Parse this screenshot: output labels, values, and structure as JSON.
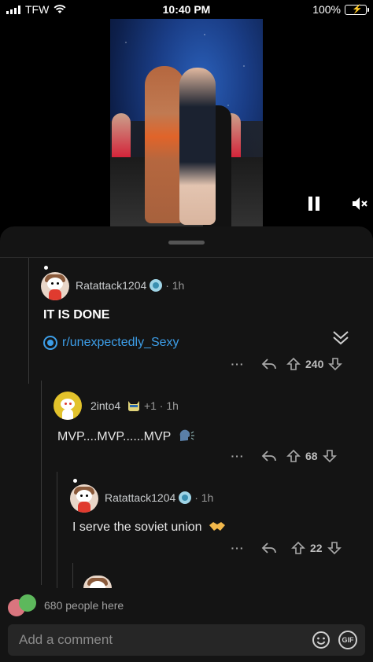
{
  "status_bar": {
    "carrier": "TFW",
    "time": "10:40 PM",
    "battery": "100%"
  },
  "video": {
    "icons": [
      "pause-icon",
      "mute-icon"
    ]
  },
  "comments": [
    {
      "author": "Ratattack1204",
      "time": "1h",
      "text": "IT IS DONE",
      "subreddit": "r/unexpectedly_Sexy",
      "votes": "240"
    },
    {
      "author": "2into4",
      "flair": "+1",
      "time": "1h",
      "text": "MVP....MVP......MVP",
      "votes": "68"
    },
    {
      "author": "Ratattack1204",
      "time": "1h",
      "text": "I serve the soviet union",
      "votes": "22"
    }
  ],
  "footer": {
    "people_here": "680 people here",
    "comment_placeholder": "Add a comment",
    "gif_label": "GIF"
  },
  "colors": {
    "link": "#3d9ee8",
    "sheet_bg": "#141414",
    "battery": "#30d158"
  }
}
